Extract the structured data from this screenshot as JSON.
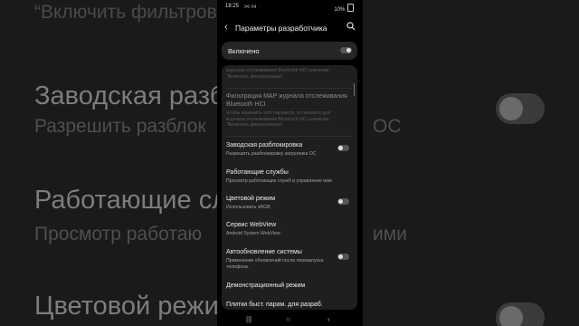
{
  "background": {
    "item_top": "“Включить фильтров",
    "item1": {
      "title": "Заводская разб",
      "sub": "Разрешить разблок",
      "sub_end": "ОС"
    },
    "item2": {
      "title": "Работающие сл",
      "sub": "Просмотр работаю",
      "sub_end": "ими"
    },
    "item3": {
      "title": "Цветовой режи"
    }
  },
  "status": {
    "time": "18:25",
    "icons": "⋈ ⋈ ·",
    "battery": "10%"
  },
  "header": {
    "back_icon": "‹",
    "title": "Параметры разработчика"
  },
  "master": {
    "label": "Включено",
    "on": true
  },
  "rows": [
    {
      "title": "",
      "sub": "журнала отслеживания Bluetooth HCI значение “Включить фильтрование”",
      "dim": true
    },
    {
      "title": "Фильтрация MAP журнала отслеживания Bluetooth HCI",
      "sub": "Чтобы изменить этот параметр, установите для журнала отслеживания Bluetooth HCI значение “Включить фильтрование”",
      "dim": true
    },
    {
      "title": "Заводская разблокировка",
      "sub": "Разрешить разблокировку загрузчика ОС",
      "toggle": false
    },
    {
      "title": "Работающие службы",
      "sub": "Просмотр работающих служб и управление ими"
    },
    {
      "title": "Цветовой режим",
      "sub": "Использовать sRGB",
      "toggle": false
    },
    {
      "title": "Сервис WebView",
      "sub": "Android System WebView"
    },
    {
      "title": "Автообновление системы",
      "sub": "Применение обновлений после перезапуска телефона.",
      "toggle": false
    },
    {
      "title": "Демонстрационный режим",
      "sub": ""
    },
    {
      "title": "Плитки быст. парам. для разраб.",
      "sub": ""
    }
  ],
  "navbar": {
    "recent": "|||",
    "home": "○",
    "back": "‹"
  }
}
